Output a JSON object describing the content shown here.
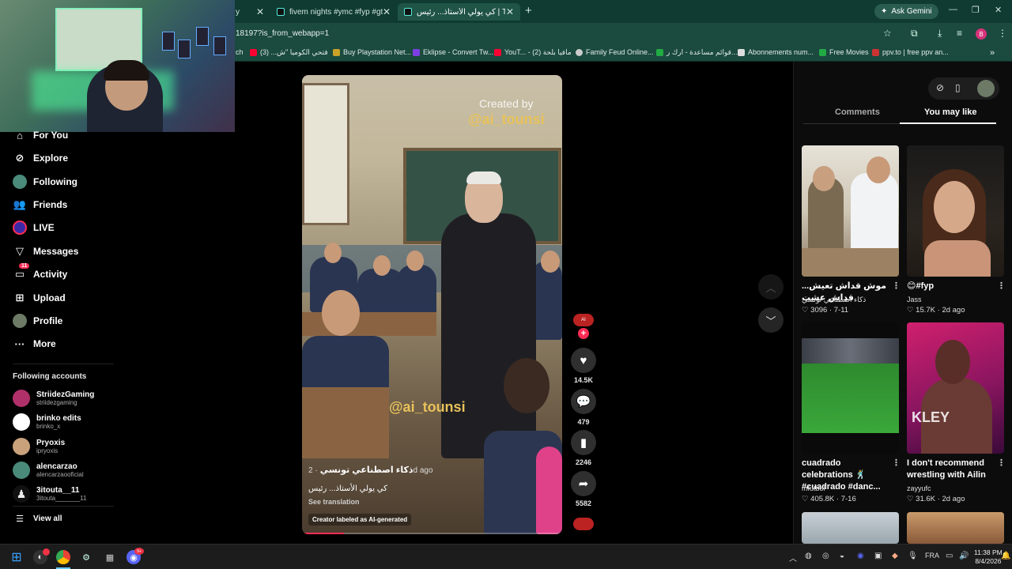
{
  "browser": {
    "tabs": [
      {
        "label": "y",
        "active": false
      },
      {
        "label": "fivem nights #ymc #fyp #gta5 #...",
        "active": false
      },
      {
        "label": "كي يولي الأستاذ... رئيس | TikTok",
        "active": true
      }
    ],
    "ask_gemini": "Ask Gemini",
    "url": "18197?is_from_webapp=1",
    "profile_initial": "B",
    "bookmarks": [
      {
        "label": "ch",
        "color": "#888888"
      },
      {
        "label": "فتحي الكوميا \"ش... (3)",
        "color": "#ff0033"
      },
      {
        "label": "Buy Playstation Net...",
        "color": "#c9a227"
      },
      {
        "label": "Eklipse - Convert Tw...",
        "color": "#7b3fe4"
      },
      {
        "label": "YouT... - مافيا بلحة (2)",
        "color": "#ff0033"
      },
      {
        "label": "Family Feud Online...",
        "color": "#cccccc"
      },
      {
        "label": "قوائم مساعدة - ارك ر...",
        "color": "#22aa44"
      },
      {
        "label": "Abonnements num...",
        "color": "#dddddd"
      },
      {
        "label": "Free Movies",
        "color": "#22aa44"
      },
      {
        "label": "ppv.to | free ppv an...",
        "color": "#cc3333"
      }
    ]
  },
  "sidebar": {
    "nav": [
      {
        "label": "For You",
        "icon": "home-icon"
      },
      {
        "label": "Explore",
        "icon": "compass-icon"
      },
      {
        "label": "Following",
        "icon": "following-avatar-icon"
      },
      {
        "label": "Friends",
        "icon": "friends-icon"
      },
      {
        "label": "LIVE",
        "icon": "live-icon"
      },
      {
        "label": "Messages",
        "icon": "messages-icon"
      },
      {
        "label": "Activity",
        "icon": "activity-icon",
        "badge": "11"
      },
      {
        "label": "Upload",
        "icon": "upload-icon"
      },
      {
        "label": "Profile",
        "icon": "profile-avatar-icon"
      },
      {
        "label": "More",
        "icon": "more-icon"
      }
    ],
    "following_title": "Following accounts",
    "accounts": [
      {
        "name": "StriidezGaming",
        "handle": "striidezgaming",
        "color": "#b0306a"
      },
      {
        "name": "brinko edits",
        "handle": "brinko_x",
        "color": "#ffffff"
      },
      {
        "name": "Pryoxis",
        "handle": "ipryoxis",
        "color": "#c9a27c"
      },
      {
        "name": "alencarzao",
        "handle": "alencarzaooficial",
        "color": "#4a8a7a"
      },
      {
        "name": "3itouta__11",
        "handle": "3itouta_______11",
        "color": "#eeeeee"
      }
    ],
    "view_all": "View all"
  },
  "video": {
    "overlay_created": "Created by",
    "overlay_handle": "@ai_tounsi",
    "watermark": "@ai_tounsi",
    "author": "ذكاء اصطناعي تونسي",
    "date": "2d ago",
    "caption": "كي يولي الأستاذ... رئيس",
    "see_translation": "See translation",
    "ai_label": "Creator labeled as AI-generated",
    "progress": 0.16
  },
  "actions": {
    "likes": "14.5K",
    "comments": "479",
    "saves": "2246",
    "shares": "5582"
  },
  "right_panel": {
    "tabs": [
      "Comments",
      "You may like"
    ],
    "active_tab": "You may like",
    "items": [
      {
        "title": "موش قداش تعيش... قداش عشت",
        "author": "ذكاء اصطناعي تونسي",
        "likes": "3096",
        "date": "7-11"
      },
      {
        "title": "😊#fyp",
        "author": "Jass",
        "likes": "15.7K",
        "date": "2d ago"
      },
      {
        "title": "cuadrado celebrations 🕺 #cuadrado #danc...",
        "author": "mfutbol",
        "likes": "405.8K",
        "date": "7-16"
      },
      {
        "title": "I don't recommend wrestling with Ailin",
        "author": "zayyufc",
        "likes": "31.6K",
        "date": "2d ago"
      }
    ]
  },
  "taskbar": {
    "language": "FRA",
    "time": "11:38 PM",
    "date": "8/4/2026",
    "discord_badge": "9+"
  }
}
